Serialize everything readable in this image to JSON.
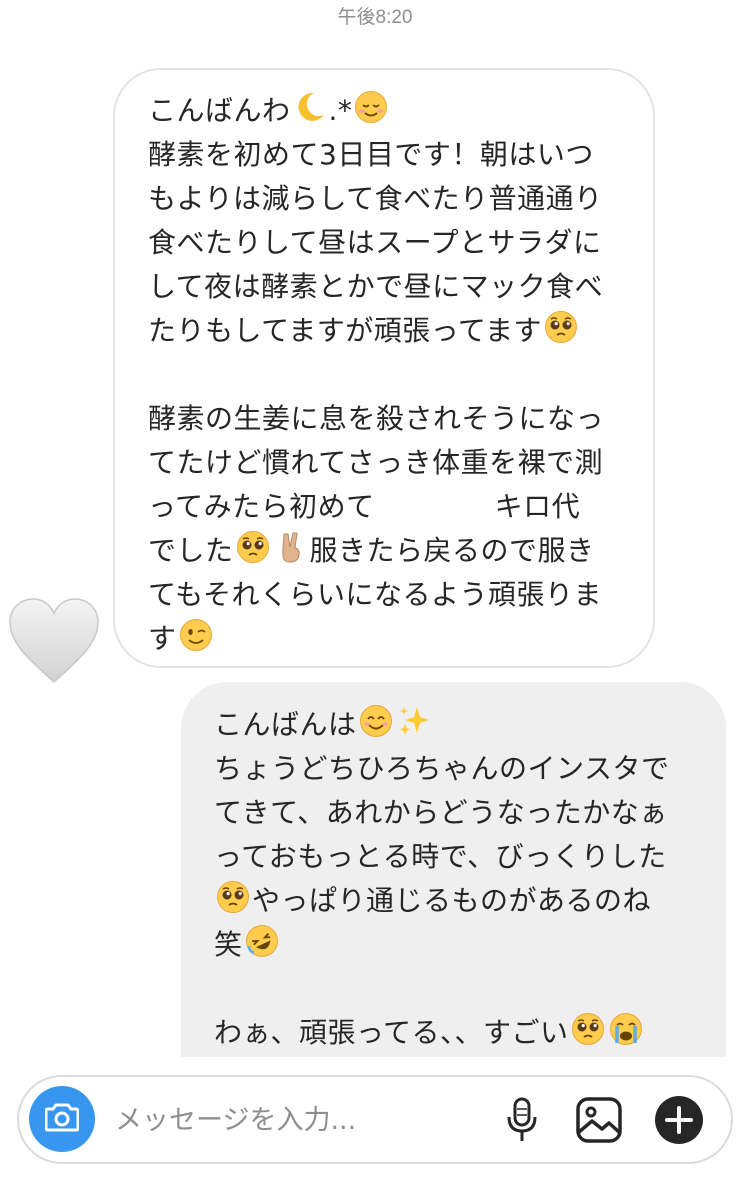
{
  "header": {
    "timestamp": "午後8:20"
  },
  "received_message": {
    "lines": [
      "こんばんわ",
      "酵素を初めて3日目です！朝はいつ",
      "もよりは減らして食べたり普通通り",
      "食べたりして昼はスープとサラダに",
      "して夜は酵素とかで昼にマック食べ",
      "たりもしてますが頑張ってます",
      "酵素の生姜に息を殺されそうになっ",
      "てたけど慣れてさっき体重を裸で測",
      "ってみたら初めて",
      "キロ代",
      "でした",
      "服きたら戻るので服き",
      "てもそれくらいになるよう頑張りま",
      "す"
    ],
    "sparkle_text": ".*",
    "reaction": "white-heart"
  },
  "sent_message": {
    "lines": [
      "こんばんは",
      "ちょうどちひろちゃんのインスタで",
      "てきて、あれからどうなったかなぁ",
      "っておもっとる時で、びっくりした",
      "やっぱり通じるものがあるのね",
      "笑",
      "わぁ、頑張ってる、、すごい"
    ]
  },
  "composer": {
    "placeholder": "メッセージを入力..."
  },
  "icons": {
    "camera": "camera-icon",
    "mic": "microphone-icon",
    "gallery": "image-icon",
    "add": "plus-icon"
  },
  "colors": {
    "accent": "#3797f0",
    "bubble_border": "#e3e3e3",
    "sent_bubble": "#efefef",
    "muted_text": "#8e8e8e"
  }
}
